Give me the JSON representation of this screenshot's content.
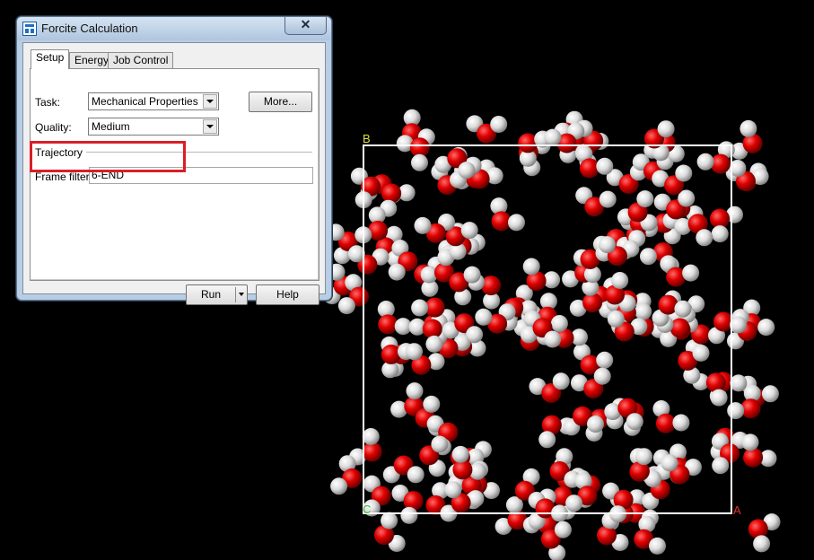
{
  "dialog": {
    "title": "Forcite Calculation",
    "close_glyph": "✕",
    "tabs": [
      {
        "label": "Setup",
        "active": true
      },
      {
        "label": "Energy",
        "active": false
      },
      {
        "label": "Job Control",
        "active": false
      }
    ],
    "task_label": "Task:",
    "task_value": "Mechanical Properties",
    "more_button": "More...",
    "quality_label": "Quality:",
    "quality_value": "Medium",
    "trajectory_label": "Trajectory",
    "frame_filter_label": "Frame filter:",
    "frame_filter_value": "6-END",
    "run_button": "Run",
    "help_button": "Help"
  },
  "viewer": {
    "axis_labels": {
      "a": "A",
      "b": "B",
      "c": "C"
    },
    "colors": {
      "oxygen": "#e00000",
      "hydrogen": "#e6e6e6",
      "cell": "#ffffff",
      "axis_a": "#e03030",
      "axis_b": "#e0e040",
      "axis_c": "#30c030",
      "highlight": "#d81f27"
    }
  }
}
